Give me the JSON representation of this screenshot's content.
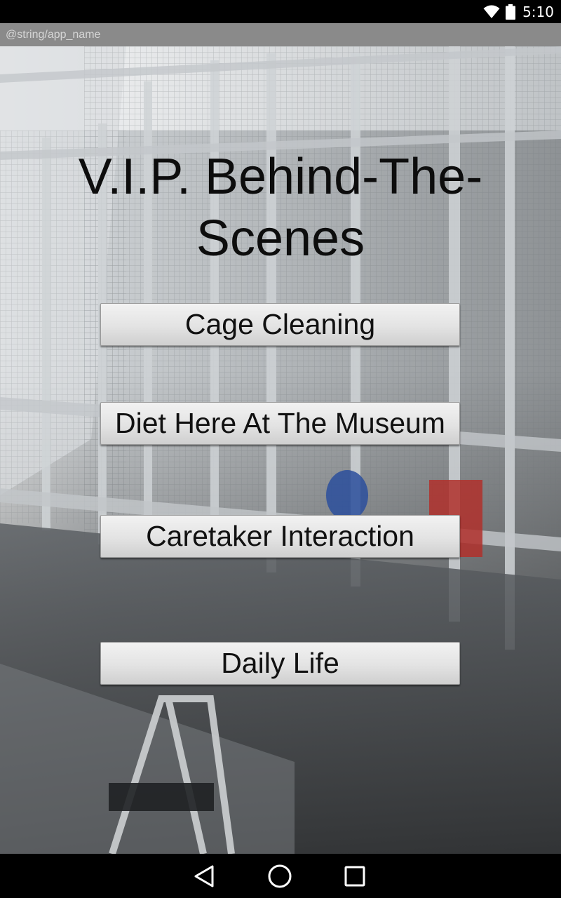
{
  "status_bar": {
    "time": "5:10",
    "icons": [
      "wifi-icon",
      "battery-icon"
    ]
  },
  "app_bar": {
    "title": "@string/app_name"
  },
  "main": {
    "title": "V.I.P. Behind-The-Scenes",
    "buttons": [
      {
        "label": "Cage Cleaning"
      },
      {
        "label": "Diet Here At The Museum"
      },
      {
        "label": "Caretaker Interaction"
      },
      {
        "label": "Daily Life"
      }
    ]
  },
  "nav_bar": {
    "icons": [
      "back-icon",
      "home-icon",
      "recents-icon"
    ]
  },
  "colors": {
    "status_bar": "#000000",
    "app_bar": "#8a8a8a",
    "app_bar_text": "#d6d6d6",
    "button_bg": "#e3e3e3",
    "title_text": "#0d0d0d"
  }
}
